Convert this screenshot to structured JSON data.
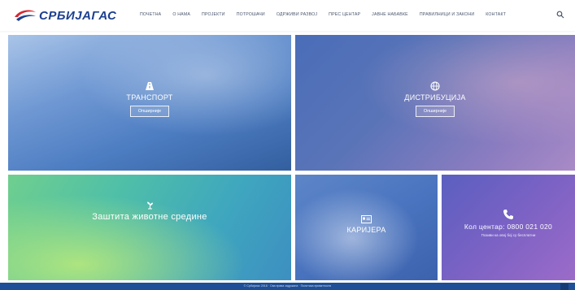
{
  "header": {
    "logo_text": "СРБИЈАГАС",
    "nav": [
      "ПОЧЕТНА",
      "О НАМА",
      "ПРОЈЕКТИ",
      "ПОТРОШАЧИ",
      "ОДРЖИВИ РАЗВОЈ",
      "ПРЕС ЦЕНТАР",
      "ЈАВНЕ НАБАВКЕ",
      "ПРАВИЛНИЦИ И ЗАКОНИ",
      "КОНТАКТ"
    ]
  },
  "tiles": {
    "transport": {
      "title": "ТРАНСПОРТ",
      "button": "Опширније"
    },
    "distribution": {
      "title": "ДИСТРИБУЦИЈА",
      "button": "Опширније"
    },
    "environment": {
      "title": "Заштита животне средине"
    },
    "career": {
      "title": "КАРИЈЕРА"
    },
    "call": {
      "title": "Кол центар: 0800 021 020",
      "subtitle": "Позиви ка овој бој су бесплатни"
    }
  },
  "footer": {
    "text": "© Србијагас 2018 · Сва права задржана · Политика приватности"
  },
  "colors": {
    "brand": "#1c3f8f",
    "accent": "#d8272f",
    "footer": "#1f4f96"
  }
}
